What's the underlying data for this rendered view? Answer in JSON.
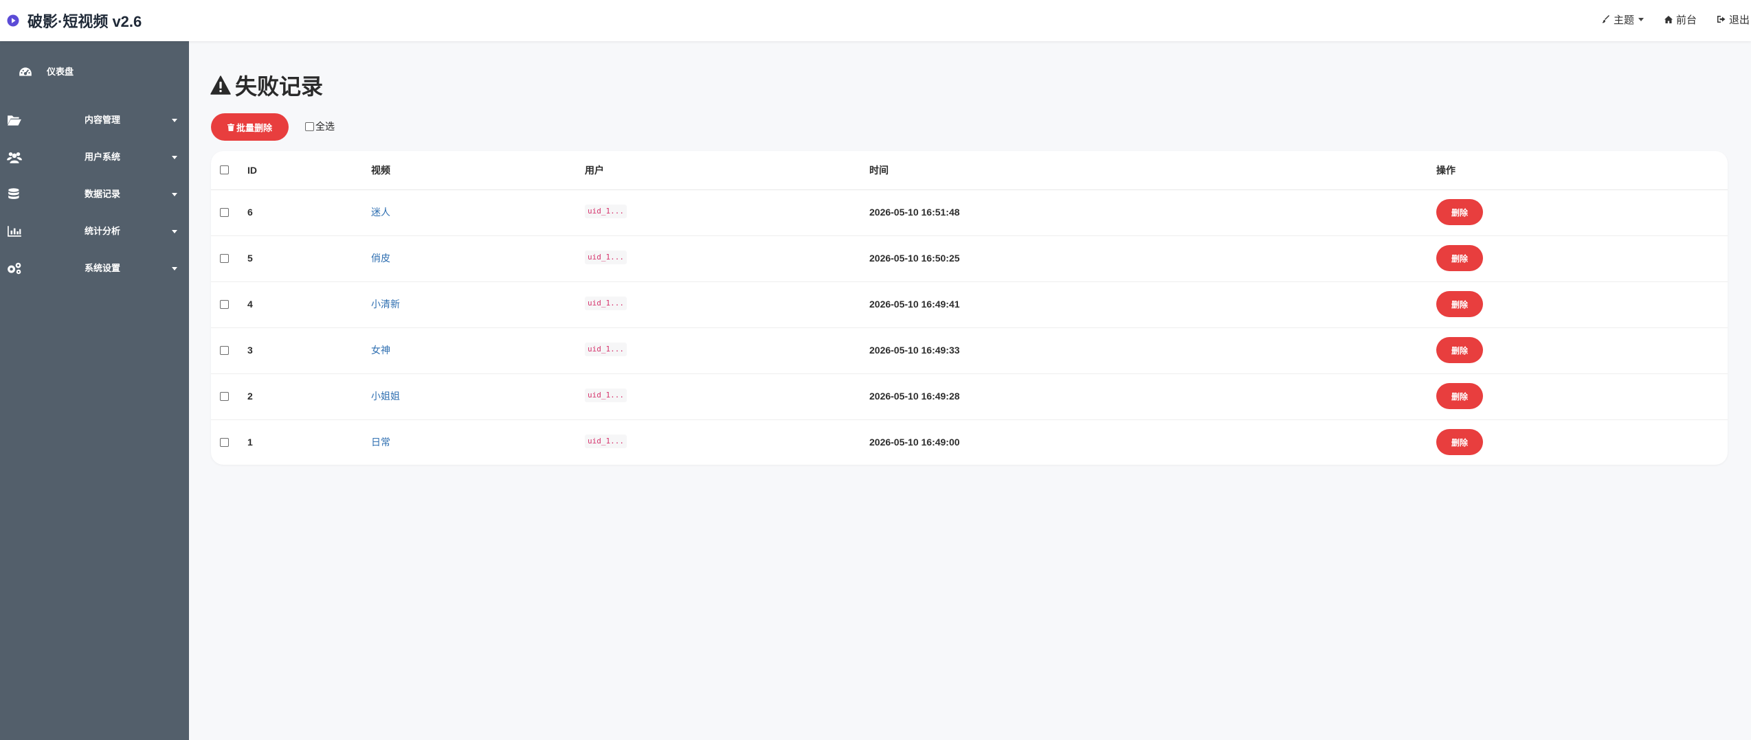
{
  "app": {
    "title": "破影·短视频 v2.6"
  },
  "navbar": {
    "theme_label": "主题",
    "front_label": "前台",
    "logout_label": "退出"
  },
  "sidebar": {
    "items": [
      {
        "label": "仪表盘",
        "icon": "dashboard-icon"
      },
      {
        "label": "内容管理",
        "icon": "folder-open-icon"
      },
      {
        "label": "用户系统",
        "icon": "users-icon"
      },
      {
        "label": "数据记录",
        "icon": "database-icon"
      },
      {
        "label": "统计分析",
        "icon": "bar-chart-icon"
      },
      {
        "label": "系统设置",
        "icon": "gears-icon"
      }
    ]
  },
  "page": {
    "title": "失败记录",
    "bulk_delete_label": "批量删除",
    "select_all_label": "全选"
  },
  "table": {
    "headers": {
      "id": "ID",
      "video": "视频",
      "user": "用户",
      "time": "时间",
      "action": "操作"
    },
    "rows": [
      {
        "id": "6",
        "video": "迷人",
        "user": "uid_1...",
        "time": "2026-05-10 16:51:48",
        "action": "删除"
      },
      {
        "id": "5",
        "video": "俏皮",
        "user": "uid_1...",
        "time": "2026-05-10 16:50:25",
        "action": "删除"
      },
      {
        "id": "4",
        "video": "小清新",
        "user": "uid_1...",
        "time": "2026-05-10 16:49:41",
        "action": "删除"
      },
      {
        "id": "3",
        "video": "女神",
        "user": "uid_1...",
        "time": "2026-05-10 16:49:33",
        "action": "删除"
      },
      {
        "id": "2",
        "video": "小姐姐",
        "user": "uid_1...",
        "time": "2026-05-10 16:49:28",
        "action": "删除"
      },
      {
        "id": "1",
        "video": "日常",
        "user": "uid_1...",
        "time": "2026-05-10 16:49:00",
        "action": "删除"
      }
    ]
  },
  "colors": {
    "sidebar_bg": "#535f6b",
    "danger": "#e83e3e",
    "link": "#2f6fb1",
    "brand_accent": "#5b4bd6",
    "page_bg": "#f7f8fa"
  }
}
